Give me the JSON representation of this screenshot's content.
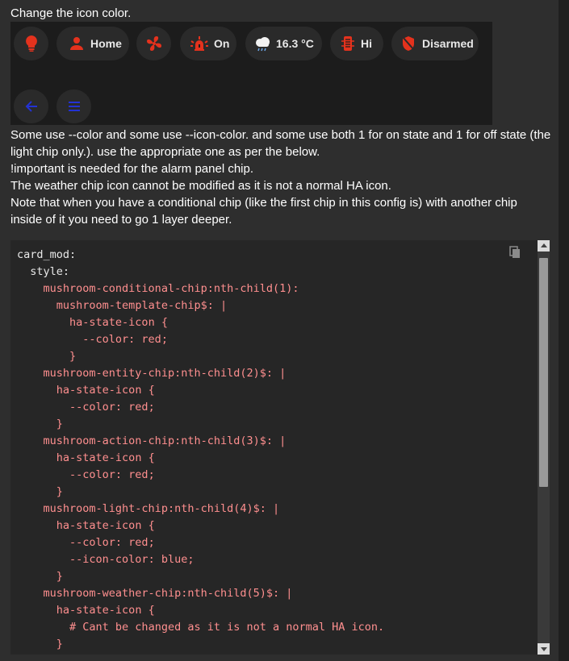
{
  "post": {
    "title": "Change the icon color.",
    "paragraphs": [
      "Some use --color and some use --icon-color. and some use both 1 for on state and 1 for off state (the light chip only.). use the appropriate one as per the below.",
      "!important is needed for the alarm panel chip.",
      "The weather chip icon cannot be modified as it is not a normal HA icon.",
      "Note that when you have a conditional chip (like the first chip in this config is) with another chip inside of it you need to go 1 layer deeper."
    ]
  },
  "chips": {
    "home_label": "Home",
    "light_label": "On",
    "weather_label": "16.3 °C",
    "climate_label": "Hi",
    "alarm_label": "Disarmed",
    "icons": [
      "lightbulb-icon",
      "person-icon",
      "fan-icon",
      "alarm-light-icon",
      "cloud-rain-icon",
      "thermostat-icon",
      "shield-off-icon",
      "arrow-left-icon",
      "menu-icon"
    ],
    "accent_red": "#e4321d",
    "accent_blue": "#2332d4"
  },
  "code": {
    "lines": [
      {
        "indent": 0,
        "parts": [
          {
            "t": "card_mod:",
            "c": ""
          }
        ]
      },
      {
        "indent": 1,
        "parts": [
          {
            "t": "style:",
            "c": ""
          }
        ]
      },
      {
        "indent": 2,
        "parts": [
          {
            "t": "mushroom-conditional-chip:nth-child(1):",
            "c": "k-sel"
          }
        ]
      },
      {
        "indent": 3,
        "parts": [
          {
            "t": "mushroom-template-chip$: |",
            "c": "k-sel"
          }
        ]
      },
      {
        "indent": 4,
        "parts": [
          {
            "t": "ha-state-icon {",
            "c": "k-sel"
          }
        ]
      },
      {
        "indent": 5,
        "parts": [
          {
            "t": "--color: red;",
            "c": "k-val"
          }
        ]
      },
      {
        "indent": 4,
        "parts": [
          {
            "t": "}",
            "c": "k-brace"
          }
        ]
      },
      {
        "indent": 2,
        "parts": [
          {
            "t": "mushroom-entity-chip:nth-child(2)$: |",
            "c": "k-sel"
          }
        ]
      },
      {
        "indent": 3,
        "parts": [
          {
            "t": "ha-state-icon {",
            "c": "k-sel"
          }
        ]
      },
      {
        "indent": 4,
        "parts": [
          {
            "t": "--color: red;",
            "c": "k-val"
          }
        ]
      },
      {
        "indent": 3,
        "parts": [
          {
            "t": "}",
            "c": "k-brace"
          }
        ]
      },
      {
        "indent": 2,
        "parts": [
          {
            "t": "mushroom-action-chip:nth-child(3)$: |",
            "c": "k-sel"
          }
        ]
      },
      {
        "indent": 3,
        "parts": [
          {
            "t": "ha-state-icon {",
            "c": "k-sel"
          }
        ]
      },
      {
        "indent": 4,
        "parts": [
          {
            "t": "--color: red;",
            "c": "k-val"
          }
        ]
      },
      {
        "indent": 3,
        "parts": [
          {
            "t": "}",
            "c": "k-brace"
          }
        ]
      },
      {
        "indent": 2,
        "parts": [
          {
            "t": "mushroom-light-chip:nth-child(4)$: |",
            "c": "k-sel"
          }
        ]
      },
      {
        "indent": 3,
        "parts": [
          {
            "t": "ha-state-icon {",
            "c": "k-sel"
          }
        ]
      },
      {
        "indent": 4,
        "parts": [
          {
            "t": "--color: red;",
            "c": "k-val"
          }
        ]
      },
      {
        "indent": 4,
        "parts": [
          {
            "t": "--icon-color: blue;",
            "c": "k-val"
          }
        ]
      },
      {
        "indent": 3,
        "parts": [
          {
            "t": "}",
            "c": "k-brace"
          }
        ]
      },
      {
        "indent": 2,
        "parts": [
          {
            "t": "mushroom-weather-chip:nth-child(5)$: |",
            "c": "k-sel"
          }
        ]
      },
      {
        "indent": 3,
        "parts": [
          {
            "t": "ha-state-icon {",
            "c": "k-sel"
          }
        ]
      },
      {
        "indent": 4,
        "parts": [
          {
            "t": "# Cant be changed as it is not a normal HA icon.",
            "c": "k-comment"
          }
        ]
      },
      {
        "indent": 3,
        "parts": [
          {
            "t": "}",
            "c": "k-brace"
          }
        ]
      }
    ]
  }
}
